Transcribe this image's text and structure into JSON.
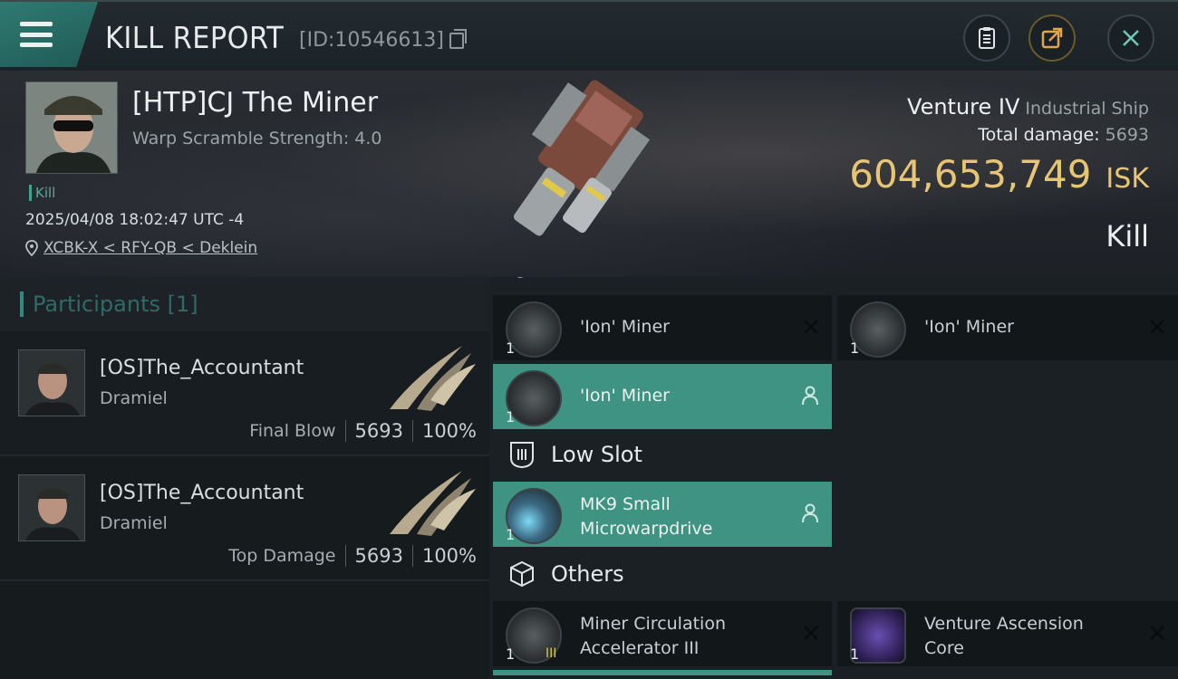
{
  "header": {
    "title": "KILL REPORT",
    "report_id": "[ID:10546613]"
  },
  "victim": {
    "name": "[HTP]CJ The Miner",
    "warp_scramble": "Warp Scramble Strength: 4.0",
    "tag": "Kill",
    "datetime": "2025/04/08 18:02:47 UTC -4",
    "location": "XCBK-X < RFY-QB < Deklein",
    "ship": "Venture IV",
    "ship_class": "Industrial Ship",
    "damage_label": "Total damage:",
    "damage_value": "5693",
    "isk_value": "604,653,749",
    "isk_unit": "ISK",
    "outcome": "Kill"
  },
  "participants": {
    "title": "Participants",
    "count": "[1]",
    "rows": [
      {
        "name": "[OS]The_Accountant",
        "ship": "Dramiel",
        "label": "Final Blow",
        "damage": "5693",
        "percent": "100%"
      },
      {
        "name": "[OS]The_Accountant",
        "ship": "Dramiel",
        "label": "Top Damage",
        "damage": "5693",
        "percent": "100%"
      }
    ]
  },
  "fitting": {
    "slots": [
      {
        "name": "'Ion' Miner",
        "qty": "1"
      },
      {
        "name": "'Ion' Miner",
        "qty": "1"
      },
      {
        "name": "'Ion' Miner",
        "qty": "1"
      }
    ],
    "low_slot_title": "Low Slot",
    "low_slots": [
      {
        "name": "MK9 Small Microwarpdrive",
        "line1": "MK9 Small",
        "line2": "Microwarpdrive",
        "qty": "1"
      }
    ],
    "others_title": "Others",
    "others": [
      {
        "line1": "Miner Circulation",
        "line2": "Accelerator III",
        "qty": "1",
        "badge": "III"
      },
      {
        "line1": "Venture Ascension",
        "line2": "Core",
        "qty": "1"
      }
    ]
  },
  "colors": {
    "accent": "#3f9383",
    "isk": "#e8c574",
    "header_tab": "#2f7a72"
  }
}
